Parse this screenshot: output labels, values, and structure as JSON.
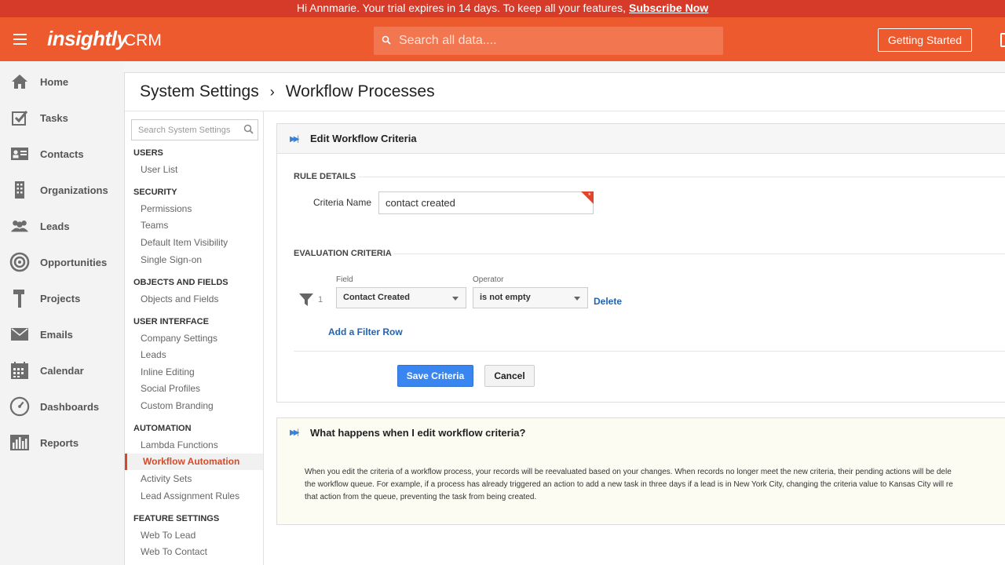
{
  "banner": {
    "message": "Hi Annmarie. Your trial expires in 14 days. To keep all your features,",
    "link": "Subscribe Now"
  },
  "header": {
    "menu_icon": "hamburger-menu-icon",
    "logo": "insightly",
    "product": "CRM",
    "search_placeholder": "Search all data....",
    "getting_started": "Getting Started"
  },
  "nav": {
    "items": [
      {
        "label": "Home",
        "icon": "home-icon"
      },
      {
        "label": "Tasks",
        "icon": "tasks-checkbox-icon"
      },
      {
        "label": "Contacts",
        "icon": "contacts-card-icon"
      },
      {
        "label": "Organizations",
        "icon": "organizations-building-icon"
      },
      {
        "label": "Leads",
        "icon": "leads-people-icon"
      },
      {
        "label": "Opportunities",
        "icon": "opportunities-target-icon"
      },
      {
        "label": "Projects",
        "icon": "projects-hammer-icon"
      },
      {
        "label": "Emails",
        "icon": "emails-envelope-icon"
      },
      {
        "label": "Calendar",
        "icon": "calendar-icon"
      },
      {
        "label": "Dashboards",
        "icon": "dashboards-gauge-icon"
      },
      {
        "label": "Reports",
        "icon": "reports-bar-icon"
      }
    ]
  },
  "breadcrumb": {
    "root": "System Settings",
    "separator": "›",
    "current": "Workflow Processes"
  },
  "settings": {
    "search_placeholder": "Search System Settings",
    "sections": [
      {
        "title": "USERS",
        "items": [
          "User List"
        ]
      },
      {
        "title": "SECURITY",
        "items": [
          "Permissions",
          "Teams",
          "Default Item Visibility",
          "Single Sign-on"
        ]
      },
      {
        "title": "OBJECTS AND FIELDS",
        "items": [
          "Objects and Fields"
        ]
      },
      {
        "title": "USER INTERFACE",
        "items": [
          "Company Settings",
          "Leads",
          "Inline Editing",
          "Social Profiles",
          "Custom Branding"
        ]
      },
      {
        "title": "AUTOMATION",
        "items": [
          "Lambda Functions",
          "Workflow Automation",
          "Activity Sets",
          "Lead Assignment Rules"
        ]
      },
      {
        "title": "FEATURE SETTINGS",
        "items": [
          "Web To Lead",
          "Web To Contact"
        ]
      }
    ],
    "active": "Workflow Automation"
  },
  "edit_panel": {
    "title": "Edit Workflow Criteria",
    "rule_details": "RULE DETAILS",
    "criteria_name_label": "Criteria Name",
    "criteria_name_value": "contact created",
    "required_mark": "*",
    "evaluation_criteria": "EVALUATION CRITERIA",
    "field_header": "Field",
    "operator_header": "Operator",
    "row_number": "1",
    "field_value": "Contact Created",
    "operator_value": "is not empty",
    "delete_label": "Delete",
    "add_row_label": "Add a Filter Row",
    "save_label": "Save Criteria",
    "cancel_label": "Cancel"
  },
  "info_panel": {
    "title": "What happens when I edit workflow criteria?",
    "lines": [
      "When you edit the criteria of a workflow process, your records will be reevaluated based on your changes. When records no longer meet the new criteria, their pending actions will be dele",
      "the workflow queue. For example, if a process has already triggered an action to add a new task in three days if a lead is in New York City, changing the criteria value to Kansas City will re",
      "that action from the queue, preventing the task from being created."
    ]
  },
  "colors": {
    "banner": "#d63a28",
    "header": "#ec5a2e",
    "active_item": "#d14a2a",
    "link": "#1f63b5",
    "primary_button": "#3a86f0"
  }
}
